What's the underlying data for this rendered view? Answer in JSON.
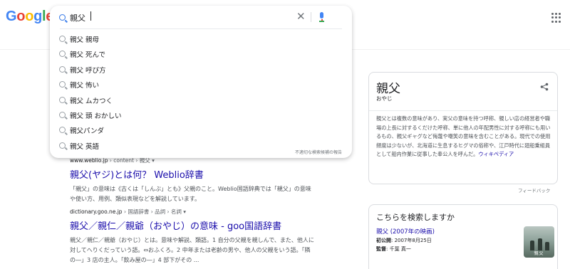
{
  "logo": {
    "text": "Google",
    "letters": [
      {
        "ch": "G",
        "color": "#4285f4"
      },
      {
        "ch": "o",
        "color": "#ea4335"
      },
      {
        "ch": "o",
        "color": "#fbbc05"
      },
      {
        "ch": "g",
        "color": "#4285f4"
      },
      {
        "ch": "l",
        "color": "#34a853"
      },
      {
        "ch": "e",
        "color": "#ea4335"
      }
    ]
  },
  "search": {
    "query": "親父",
    "suggestions": [
      "親父 親母",
      "親父 死んで",
      "親父 呼び方",
      "親父 怖い",
      "親父 ムカつく",
      "親父 頭 おかしい",
      "親父パンダ",
      "親父 英語"
    ],
    "report_label": "不適切な検索候補の報告"
  },
  "icons": {
    "search": "search-icon",
    "clear": "close-icon",
    "mic": "mic-icon",
    "apps": "apps-grid-icon",
    "share": "share-icon"
  },
  "results": [
    {
      "url": "www.weblio.jp",
      "crumbs": " › content › 親父 ▾",
      "title": "親父(ヤジ)とは何？ Weblio辞書",
      "snippet_line1": "「親父」の意味は《古くは「しんぶ」とも》父親のこと。Weblio国語辞典では「親父」の意味",
      "snippet_line2": "や使い方、用例、類似表現などを解説しています。"
    },
    {
      "url": "dictionary.goo.ne.jp",
      "crumbs": " › 国語辞書 › 品詞 › 名詞 ▾",
      "title": "親父／親仁／親爺（おやじ）の意味 - goo国語辞書",
      "snippet_line1": "親父／親仁／親爺（おやじ）とは。意味や解説、類語。1 自分の父親を親しんで、また、他人に",
      "snippet_line2": "対してへりくだっていう語。⇔おふくろ。2 中年または老齢の男や、他人の父親をいう語。「隣",
      "snippet_line3": "の―」3 店の主人。「飲み屋の―」4 部下がその ..."
    }
  ],
  "knowledge_panel": {
    "title": "親父",
    "subtitle": "おやじ",
    "description": "親父とは複数の意味があり、実父の意味を持つ呼称、親しい店の経営者や職場の上長に対するくだけた呼称、単に他人の年配男性に対する呼称にも用いるもの、親父ギャグなど侮蔑や嘲笑の意味を含むことがある。現代での使用頻度は少ないが、北海道に生息するヒグマの俗称や、江戸時代に廻船乗組員として船内作業に従事した奉公人を呼んだ。",
    "source_link": "ウィキペディア",
    "feedback": "フィードバック"
  },
  "also_search": {
    "heading": "こちらを検索しますか",
    "item_title": "親父 (2007年の映画)",
    "release_label": "初公開",
    "release_value": "2007年8月25日",
    "director_label": "監督",
    "director_value": "千葉 真一",
    "thumb_caption": "親父"
  },
  "colors": {
    "link": "#1a0dab",
    "accent_blue": "#4285f4"
  }
}
